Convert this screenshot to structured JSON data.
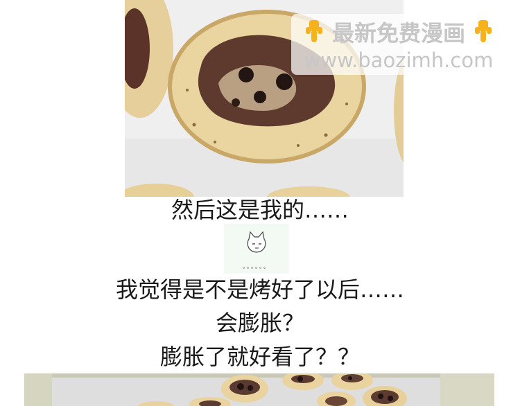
{
  "watermark": {
    "title": "最新免费漫画",
    "url": "www.baozimh.com",
    "left_icon": "pointing-down-hand-icon",
    "right_icon": "pointing-down-hand-icon"
  },
  "photo_top": {
    "subject": "cookie-photo"
  },
  "captions": {
    "line1": "然后这是我的……",
    "line2": "我觉得是不是烤好了以后……",
    "line3": "会膨胀？",
    "line4": "膨胀了就好看了？？"
  },
  "sticker": {
    "dots": "。。。。。。",
    "icon": "cat-face-icon"
  },
  "photo_bottom": {
    "subject": "cookies-tray-photo"
  }
}
